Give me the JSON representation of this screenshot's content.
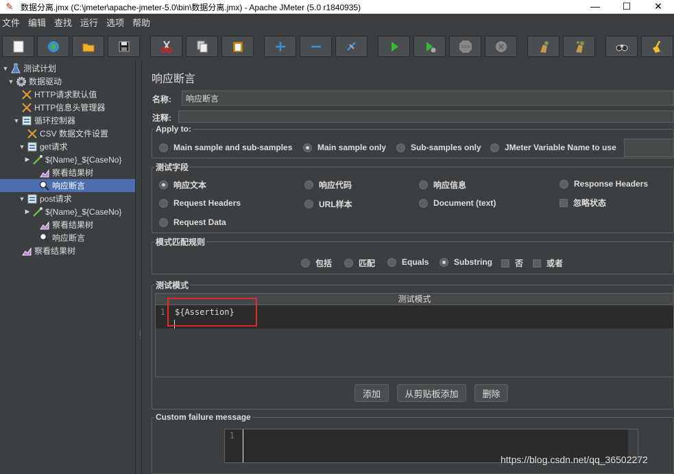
{
  "window": {
    "title": "数据分离.jmx (C:\\jmeter\\apache-jmeter-5.0\\bin\\数据分离.jmx) - Apache JMeter (5.0 r1840935)",
    "minimize": "—",
    "maximize": "☐",
    "close": "✕"
  },
  "menu": [
    "文件",
    "编辑",
    "查找",
    "运行",
    "选项",
    "帮助"
  ],
  "toolbar": {
    "buttons": [
      "new-icon",
      "templates-icon",
      "open-icon",
      "save-icon",
      "cut-icon",
      "copy-icon",
      "paste-icon",
      "expand-icon",
      "collapse-icon",
      "toggle-icon",
      "start-icon",
      "start-no-pause-icon",
      "stop-icon",
      "shutdown-icon",
      "clear-icon",
      "clear-all-icon",
      "search-icon",
      "reset-search-icon"
    ]
  },
  "tree": [
    {
      "label": "测试计划",
      "icon": "flask-icon",
      "toggle": "▼"
    },
    {
      "label": "数据驱动",
      "icon": "gear-icon",
      "toggle": "▼"
    },
    {
      "label": "HTTP请求默认值",
      "icon": "wrench-icon",
      "toggle": ""
    },
    {
      "label": "HTTP信息头管理器",
      "icon": "wrench-icon",
      "toggle": ""
    },
    {
      "label": "循环控制器",
      "icon": "controller-icon",
      "toggle": "▼"
    },
    {
      "label": "CSV 数据文件设置",
      "icon": "wrench-icon",
      "toggle": ""
    },
    {
      "label": "get请求",
      "icon": "controller-icon",
      "toggle": "▼"
    },
    {
      "label": "${Name}_${CaseNo}",
      "icon": "pipette-icon",
      "toggle": "▶"
    },
    {
      "label": "察看结果树",
      "icon": "chart-icon",
      "toggle": ""
    },
    {
      "label": "响应断言",
      "icon": "magnifier-icon",
      "toggle": ""
    },
    {
      "label": "post请求",
      "icon": "controller-icon",
      "toggle": "▼"
    },
    {
      "label": "${Name}_${CaseNo}",
      "icon": "pipette-icon",
      "toggle": "▶"
    },
    {
      "label": "察看结果树",
      "icon": "chart-icon",
      "toggle": ""
    },
    {
      "label": "响应断言",
      "icon": "magnifier-icon",
      "toggle": ""
    },
    {
      "label": "察看结果树",
      "icon": "chart-icon",
      "toggle": ""
    }
  ],
  "panel": {
    "title": "响应断言",
    "name_label": "名称:",
    "name_value": "响应断言",
    "comment_label": "注释:",
    "comment_value": "",
    "apply_to": {
      "legend": "Apply to:",
      "options": [
        "Main sample and sub-samples",
        "Main sample only",
        "Sub-samples only",
        "JMeter Variable Name to use"
      ],
      "selected": "Main sample only"
    },
    "field_to_test": {
      "legend": "测试字段",
      "options": [
        "响应文本",
        "响应代码",
        "响应信息",
        "Response Headers",
        "Request Headers",
        "URL样本",
        "Document (text)",
        "Request Data"
      ],
      "ignore_status": "忽略状态",
      "selected": "响应文本"
    },
    "pattern_matching": {
      "legend": "模式匹配规则",
      "options": [
        "包括",
        "匹配",
        "Equals",
        "Substring"
      ],
      "checks": [
        "否",
        "或者"
      ],
      "selected": "Substring"
    },
    "patterns": {
      "legend": "测试模式",
      "header": "测试模式",
      "line_no": "1",
      "value": "${Assertion}",
      "buttons": [
        "添加",
        "从剪贴板添加",
        "删除"
      ]
    },
    "failure": {
      "legend": "Custom failure message",
      "line_no": "1",
      "value": ""
    }
  },
  "watermark": "https://blog.csdn.net/qq_36502272"
}
